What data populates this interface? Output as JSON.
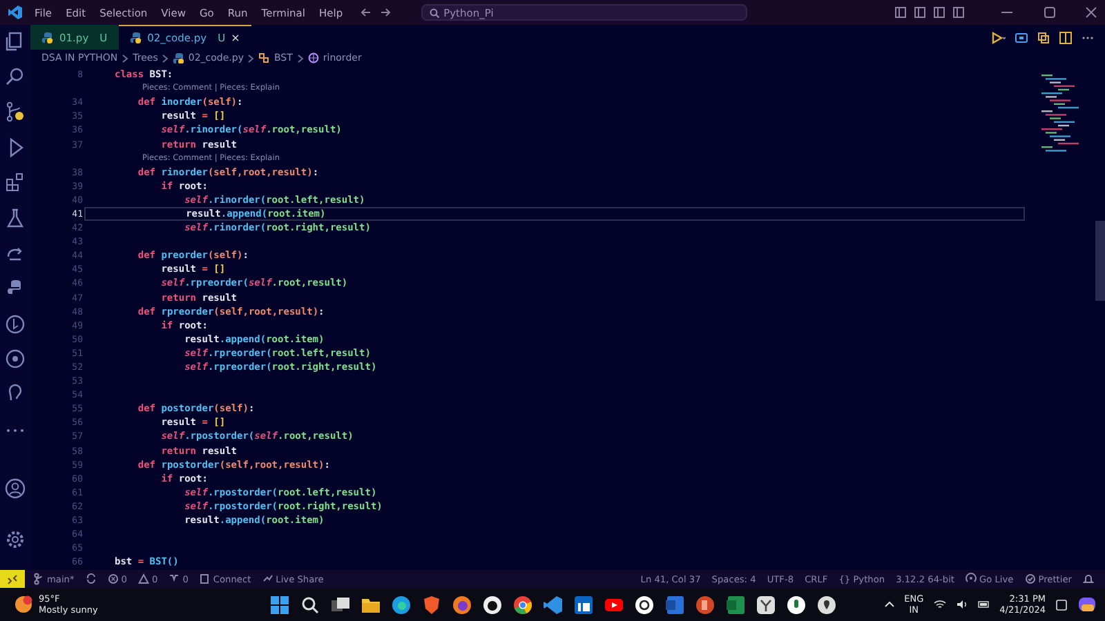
{
  "title_bar": {
    "menu": [
      "File",
      "Edit",
      "Selection",
      "View",
      "Go",
      "Run",
      "Terminal",
      "Help"
    ],
    "search": "Python_Pi"
  },
  "tabs": [
    {
      "label": "01.py",
      "badge": "U",
      "selected": false
    },
    {
      "label": "02_code.py",
      "badge": "U",
      "close": "×",
      "selected": true
    }
  ],
  "breadcrumb": [
    "DSA IN PYTHON",
    "Trees",
    "02_code.py",
    "BST",
    "rinorder"
  ],
  "editor": {
    "lines": [
      {
        "kind": "code",
        "number": "8",
        "current": false,
        "tokens": [
          {
            "text": "class",
            "kind": "kw"
          },
          {
            "text": " BST:",
            "kind": "plain"
          }
        ]
      },
      {
        "kind": "lens",
        "text": "Pieces: Comment | Pieces: Explain"
      },
      {
        "kind": "code",
        "number": "34",
        "current": false,
        "tokens": [
          {
            "text": "    def",
            "kind": "kw"
          },
          {
            "text": " inorder",
            "kind": "fn"
          },
          {
            "text": "(self)",
            "kind": "param"
          },
          {
            "text": ":",
            "kind": "plain"
          }
        ]
      },
      {
        "kind": "code",
        "number": "35",
        "current": false,
        "tokens": [
          {
            "text": "        result ",
            "kind": "plain"
          },
          {
            "text": "=",
            "kind": "op"
          },
          {
            "text": " []",
            "kind": "bracket"
          }
        ]
      },
      {
        "kind": "code",
        "number": "36",
        "current": false,
        "tokens": [
          {
            "text": "        self",
            "kind": "self"
          },
          {
            "text": ".rinorder(",
            "kind": "fn"
          },
          {
            "text": "self",
            "kind": "self"
          },
          {
            "text": ".root,result)",
            "kind": "attr"
          }
        ]
      },
      {
        "kind": "code",
        "number": "37",
        "current": false,
        "tokens": [
          {
            "text": "        return",
            "kind": "kw"
          },
          {
            "text": " result",
            "kind": "plain"
          }
        ]
      },
      {
        "kind": "lens",
        "text": "Pieces: Comment | Pieces: Explain"
      },
      {
        "kind": "code",
        "number": "38",
        "current": false,
        "tokens": [
          {
            "text": "    def",
            "kind": "kw"
          },
          {
            "text": " rinorder",
            "kind": "fn"
          },
          {
            "text": "(self,root,result)",
            "kind": "param"
          },
          {
            "text": ":",
            "kind": "plain"
          }
        ]
      },
      {
        "kind": "code",
        "number": "39",
        "current": false,
        "tokens": [
          {
            "text": "        if",
            "kind": "kw"
          },
          {
            "text": " root:",
            "kind": "plain"
          }
        ]
      },
      {
        "kind": "code",
        "number": "40",
        "current": false,
        "tokens": [
          {
            "text": "            self",
            "kind": "self"
          },
          {
            "text": ".rinorder(",
            "kind": "fn"
          },
          {
            "text": "root.left,result)",
            "kind": "attr"
          }
        ]
      },
      {
        "kind": "code",
        "number": "41",
        "current": true,
        "tokens": [
          {
            "text": "            result",
            "kind": "plain"
          },
          {
            "text": ".append(",
            "kind": "fn"
          },
          {
            "text": "root.item)",
            "kind": "attr"
          }
        ]
      },
      {
        "kind": "code",
        "number": "42",
        "current": false,
        "tokens": [
          {
            "text": "            self",
            "kind": "self"
          },
          {
            "text": ".rinorder(",
            "kind": "fn"
          },
          {
            "text": "root.right,result)",
            "kind": "attr"
          }
        ]
      },
      {
        "kind": "code",
        "number": "43",
        "current": false
      },
      {
        "kind": "code",
        "number": "44",
        "current": false,
        "tokens": [
          {
            "text": "    def",
            "kind": "kw"
          },
          {
            "text": " preorder",
            "kind": "fn"
          },
          {
            "text": "(self)",
            "kind": "param"
          },
          {
            "text": ":",
            "kind": "plain"
          }
        ]
      },
      {
        "kind": "code",
        "number": "45",
        "current": false,
        "tokens": [
          {
            "text": "        result ",
            "kind": "plain"
          },
          {
            "text": "=",
            "kind": "op"
          },
          {
            "text": " []",
            "kind": "bracket"
          }
        ]
      },
      {
        "kind": "code",
        "number": "46",
        "current": false,
        "tokens": [
          {
            "text": "        self",
            "kind": "self"
          },
          {
            "text": ".rpreorder(",
            "kind": "fn"
          },
          {
            "text": "self",
            "kind": "self"
          },
          {
            "text": ".root,result)",
            "kind": "attr"
          }
        ]
      },
      {
        "kind": "code",
        "number": "47",
        "current": false,
        "tokens": [
          {
            "text": "        return",
            "kind": "kw"
          },
          {
            "text": " result",
            "kind": "plain"
          }
        ]
      },
      {
        "kind": "code",
        "number": "48",
        "current": false,
        "tokens": [
          {
            "text": "    def",
            "kind": "kw"
          },
          {
            "text": " rpreorder",
            "kind": "fn"
          },
          {
            "text": "(self,root,result)",
            "kind": "param"
          },
          {
            "text": ":",
            "kind": "plain"
          }
        ]
      },
      {
        "kind": "code",
        "number": "49",
        "current": false,
        "tokens": [
          {
            "text": "        if",
            "kind": "kw"
          },
          {
            "text": " root:",
            "kind": "plain"
          }
        ]
      },
      {
        "kind": "code",
        "number": "50",
        "current": false,
        "tokens": [
          {
            "text": "            result",
            "kind": "plain"
          },
          {
            "text": ".append(",
            "kind": "fn"
          },
          {
            "text": "root.item)",
            "kind": "attr"
          }
        ]
      },
      {
        "kind": "code",
        "number": "51",
        "current": false,
        "tokens": [
          {
            "text": "            self",
            "kind": "self"
          },
          {
            "text": ".rpreorder(",
            "kind": "fn"
          },
          {
            "text": "root.left,result)",
            "kind": "attr"
          }
        ]
      },
      {
        "kind": "code",
        "number": "52",
        "current": false,
        "tokens": [
          {
            "text": "            self",
            "kind": "self"
          },
          {
            "text": ".rpreorder(",
            "kind": "fn"
          },
          {
            "text": "root.right,result)",
            "kind": "attr"
          }
        ]
      },
      {
        "kind": "code",
        "number": "53",
        "current": false
      },
      {
        "kind": "code",
        "number": "54",
        "current": false
      },
      {
        "kind": "code",
        "number": "55",
        "current": false,
        "tokens": [
          {
            "text": "    def",
            "kind": "kw"
          },
          {
            "text": " postorder",
            "kind": "fn"
          },
          {
            "text": "(self)",
            "kind": "param"
          },
          {
            "text": ":",
            "kind": "plain"
          }
        ]
      },
      {
        "kind": "code",
        "number": "56",
        "current": false,
        "tokens": [
          {
            "text": "        result ",
            "kind": "plain"
          },
          {
            "text": "=",
            "kind": "op"
          },
          {
            "text": " []",
            "kind": "bracket"
          }
        ]
      },
      {
        "kind": "code",
        "number": "57",
        "current": false,
        "tokens": [
          {
            "text": "        self",
            "kind": "self"
          },
          {
            "text": ".rpostorder(",
            "kind": "fn"
          },
          {
            "text": "self",
            "kind": "self"
          },
          {
            "text": ".root,result)",
            "kind": "attr"
          }
        ]
      },
      {
        "kind": "code",
        "number": "58",
        "current": false,
        "tokens": [
          {
            "text": "        return",
            "kind": "kw"
          },
          {
            "text": " result",
            "kind": "plain"
          }
        ]
      },
      {
        "kind": "code",
        "number": "59",
        "current": false,
        "tokens": [
          {
            "text": "    def",
            "kind": "kw"
          },
          {
            "text": " rpostorder",
            "kind": "fn"
          },
          {
            "text": "(self,root,result)",
            "kind": "param"
          },
          {
            "text": ":",
            "kind": "plain"
          }
        ]
      },
      {
        "kind": "code",
        "number": "60",
        "current": false,
        "tokens": [
          {
            "text": "        if",
            "kind": "kw"
          },
          {
            "text": " root:",
            "kind": "plain"
          }
        ]
      },
      {
        "kind": "code",
        "number": "61",
        "current": false,
        "tokens": [
          {
            "text": "            self",
            "kind": "self"
          },
          {
            "text": ".rpostorder(",
            "kind": "fn"
          },
          {
            "text": "root.left,result)",
            "kind": "attr"
          }
        ]
      },
      {
        "kind": "code",
        "number": "62",
        "current": false,
        "tokens": [
          {
            "text": "            self",
            "kind": "self"
          },
          {
            "text": ".rpostorder(",
            "kind": "fn"
          },
          {
            "text": "root.right,result)",
            "kind": "attr"
          }
        ]
      },
      {
        "kind": "code",
        "number": "63",
        "current": false,
        "tokens": [
          {
            "text": "            result",
            "kind": "plain"
          },
          {
            "text": ".append(",
            "kind": "fn"
          },
          {
            "text": "root.item)",
            "kind": "attr"
          }
        ]
      },
      {
        "kind": "code",
        "number": "64",
        "current": false
      },
      {
        "kind": "code",
        "number": "65",
        "current": false
      },
      {
        "kind": "code",
        "number": "66",
        "current": false,
        "tokens": [
          {
            "text": "bst ",
            "kind": "plain"
          },
          {
            "text": "=",
            "kind": "op"
          },
          {
            "text": " BST()",
            "kind": "fn"
          }
        ]
      }
    ]
  },
  "status_bar": {
    "left": [
      {
        "kind": "branch",
        "text": "main*"
      },
      {
        "kind": "sync"
      },
      {
        "kind": "error",
        "text": "0"
      },
      {
        "kind": "warning",
        "text": "0"
      },
      {
        "kind": "ports",
        "text": "0"
      },
      {
        "kind": "plug",
        "text": "Connect"
      },
      {
        "kind": "share",
        "text": "Live Share"
      }
    ],
    "right": [
      {
        "kind": "plain",
        "text": "Ln 41, Col 37"
      },
      {
        "kind": "plain",
        "text": "Spaces: 4"
      },
      {
        "kind": "plain",
        "text": "UTF-8"
      },
      {
        "kind": "plain",
        "text": "CRLF"
      },
      {
        "kind": "plain",
        "text": "{} Python"
      },
      {
        "kind": "plain",
        "text": "3.12.2 64-bit"
      },
      {
        "kind": "broadcast",
        "text": "Go Live"
      },
      {
        "kind": "check",
        "text": "Prettier"
      },
      {
        "kind": "bell"
      }
    ]
  },
  "taskbar": {
    "weather": {
      "temp": "95°F",
      "condition": "Mostly sunny"
    },
    "language": [
      "ENG",
      "IN"
    ],
    "time": "2:31 PM",
    "date": "4/21/2024"
  }
}
